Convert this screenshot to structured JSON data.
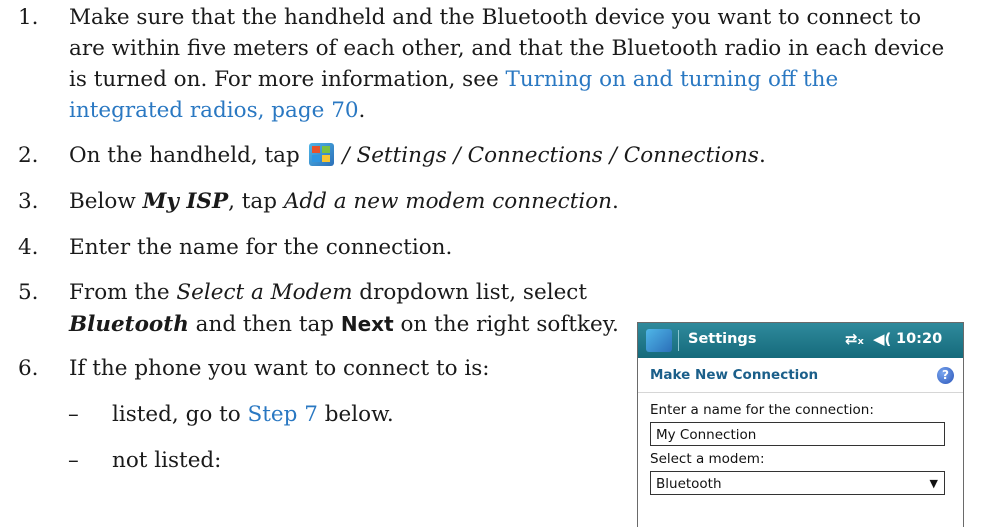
{
  "steps": [
    {
      "num": "1.",
      "lines": [
        "Make sure that the handheld and the Bluetooth device you want to connect to",
        "are within five meters of each other, and that the Bluetooth radio in each device",
        "is turned on. For more information, see "
      ],
      "link_part1": "Turning on and turning off the",
      "link_part2": "integrated radios, page 70",
      "end": "."
    },
    {
      "num": "2.",
      "prefix": "On the handheld, tap ",
      "path": " / Settings / Connections / Connections",
      "end": "."
    },
    {
      "num": "3.",
      "prefix": "Below ",
      "bold": "My ISP",
      "mid": ", tap ",
      "italic": "Add a new modem connection",
      "end": "."
    },
    {
      "num": "4.",
      "text": "Enter the name for the connection."
    },
    {
      "num": "5.",
      "prefix": "From the ",
      "italic": "Select a Modem",
      "mid": " dropdown list, select",
      "bold": "Bluetooth",
      "mid2": " and then tap ",
      "softkey": "Next",
      "end": " on the right softkey."
    },
    {
      "num": "6.",
      "text": "If the phone you want to connect to is:"
    }
  ],
  "substeps": [
    {
      "dash": "–",
      "prefix": "listed, go to ",
      "link": "Step 7",
      "end": " below."
    },
    {
      "dash": "–",
      "text": "not listed:"
    }
  ],
  "device": {
    "title": "Settings",
    "time": "10:20",
    "conn_icon": "⇄ₓ",
    "vol_icon": "◀(",
    "header": "Make New Connection",
    "help": "?",
    "name_label": "Enter a name for the connection:",
    "name_value": "My Connection",
    "modem_label": "Select a modem:",
    "modem_value": "Bluetooth",
    "dropdown_icon": "▼"
  },
  "colors": {
    "link": "#2a78c2",
    "titlebar": "#156a7b",
    "header_text": "#1b5f8a"
  }
}
